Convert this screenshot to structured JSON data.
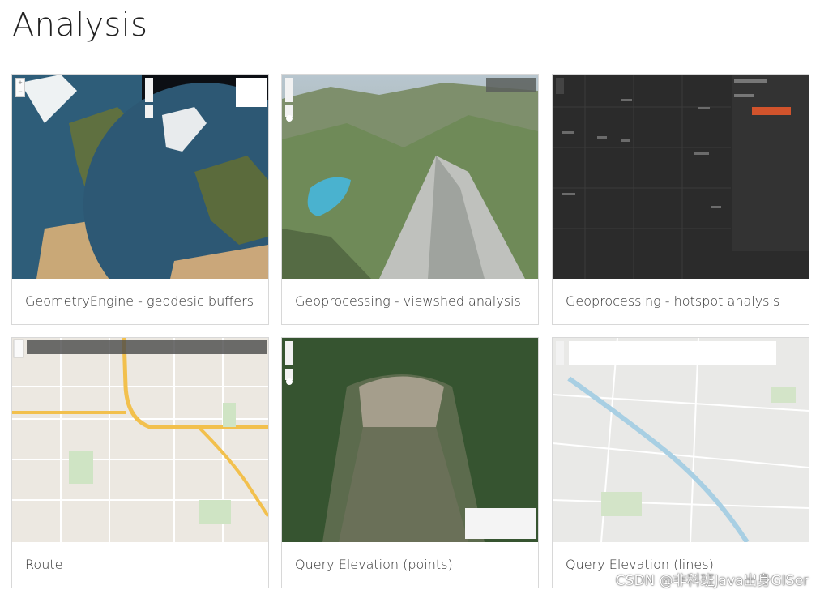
{
  "page": {
    "title": "Analysis"
  },
  "cards": [
    {
      "caption": "GeometryEngine - geodesic buffers"
    },
    {
      "caption": "Geoprocessing - viewshed analysis"
    },
    {
      "caption": "Geoprocessing - hotspot analysis"
    },
    {
      "caption": "Route"
    },
    {
      "caption": "Query Elevation (points)"
    },
    {
      "caption": "Query Elevation (lines)"
    }
  ],
  "watermark": "CSDN @非科班Java出身GISer",
  "colors": {
    "card_border": "#d8d8d8",
    "caption_text": "#333333",
    "hotspot_button": "#d1532c"
  }
}
